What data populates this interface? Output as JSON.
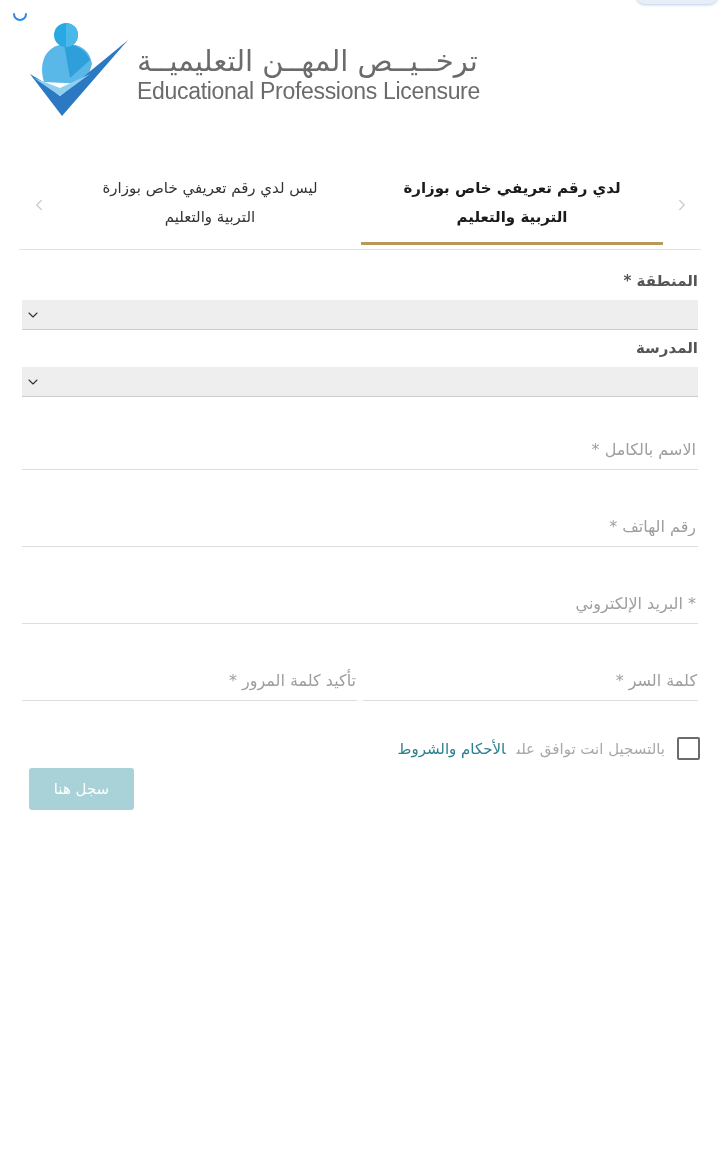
{
  "logo": {
    "title_ar": "ترخــيــص المهــن التعليميــة",
    "title_en": "Educational Professions Licensure"
  },
  "tabs": [
    {
      "lines": [
        "لدي رقم تعريفي خاص بوزارة",
        "التربية والتعليم"
      ],
      "selected": true
    },
    {
      "lines": [
        "ليس لدي رقم تعريفي خاص بوزارة",
        "التربية والتعليم"
      ],
      "selected": false
    }
  ],
  "form": {
    "fields": [
      {
        "kind": "select",
        "label": "المنطقة *"
      },
      {
        "kind": "select",
        "label": "المدرسة"
      },
      {
        "kind": "input",
        "placeholder": "الاسم بالكامل *"
      },
      {
        "kind": "input",
        "placeholder": "رقم الهاتف *"
      },
      {
        "kind": "input",
        "placeholder": "* البريد الإلكتروني"
      }
    ],
    "password_fields": [
      {
        "placeholder": "كلمة السر *"
      },
      {
        "placeholder": "تأكيد كلمة المرور *"
      }
    ]
  },
  "terms": {
    "checked": false,
    "text": "بالتسجيل انت توافق على",
    "link": "الأحكام والشروط"
  },
  "submit": {
    "label": "سجل هنا",
    "disabled": true
  }
}
